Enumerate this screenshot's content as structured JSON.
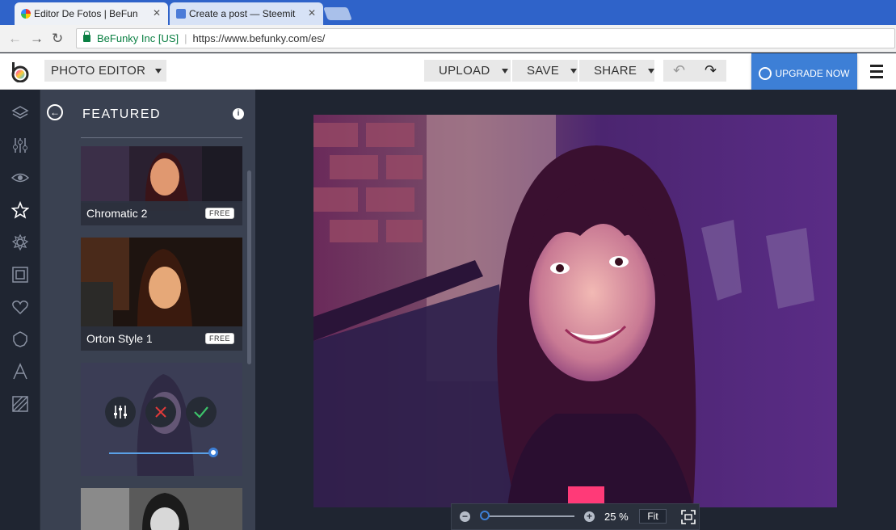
{
  "browser": {
    "tabs": [
      {
        "title": "Editor De Fotos  |  BeFun"
      },
      {
        "title": "Create a post — Steemit"
      }
    ],
    "secure_label": "BeFunky Inc [US]",
    "url": "https://www.befunky.com/es/"
  },
  "header": {
    "editor_label": "PHOTO EDITOR",
    "upload_label": "UPLOAD",
    "save_label": "SAVE",
    "share_label": "SHARE",
    "upgrade_label": "UPGRADE NOW"
  },
  "rail": {
    "icons": [
      "layers-icon",
      "sliders-icon",
      "eye-icon",
      "star-icon",
      "flower-icon",
      "frame-icon",
      "heart-icon",
      "badge-icon",
      "text-icon",
      "texture-icon"
    ]
  },
  "panel": {
    "title": "FEATURED",
    "cards": [
      {
        "label": "Chromatic 2",
        "badge": "FREE"
      },
      {
        "label": "Orton Style 1",
        "badge": "FREE"
      }
    ]
  },
  "zoom": {
    "percent": "25 %",
    "fit_label": "Fit"
  },
  "colors": {
    "accent": "#3d7fd6",
    "panel": "#3a4151",
    "background": "#1f2531"
  }
}
